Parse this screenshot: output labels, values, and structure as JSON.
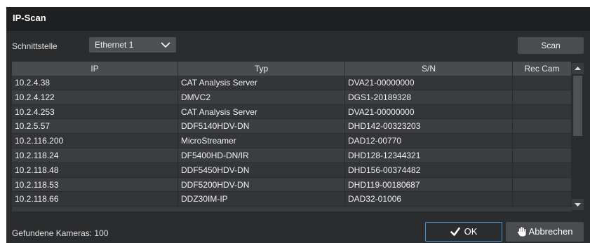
{
  "dialog": {
    "title": "IP-Scan",
    "interface_label": "Schnittstelle",
    "interface_value": "Ethernet 1",
    "scan_label": "Scan"
  },
  "table": {
    "headers": [
      "IP",
      "Typ",
      "S/N",
      "Rec Cam"
    ],
    "rows": [
      [
        "10.2.4.38",
        "CAT Analysis Server",
        "DVA21-00000000",
        ""
      ],
      [
        "10.2.4.122",
        "DMVC2",
        "DGS1-20189328",
        ""
      ],
      [
        "10.2.4.253",
        "CAT Analysis Server",
        "DVA21-00000000",
        ""
      ],
      [
        "10.2.5.57",
        "DDF5140HDV-DN",
        "DHD142-00323203",
        ""
      ],
      [
        "10.2.116.200",
        "MicroStreamer",
        "DAD12-00770",
        ""
      ],
      [
        "10.2.118.24",
        "DF5400HD-DN/IR",
        "DHD128-12344321",
        ""
      ],
      [
        "10.2.118.48",
        "DDF5450HDV-DN",
        "DHD156-00374482",
        ""
      ],
      [
        "10.2.118.53",
        "DDF5200HDV-DN",
        "DHD119-00180687",
        ""
      ],
      [
        "10.2.118.66",
        "DDZ30IM-IP",
        "DAD32-01006",
        ""
      ]
    ]
  },
  "footer": {
    "found_label": "Gefundene Kameras: 100",
    "ok_label": "OK",
    "cancel_label": "Abbrechen"
  },
  "icons": {
    "dropdown": "chevron-down-icon",
    "ok": "checkmark-icon",
    "cancel": "hand-icon",
    "scroll_up": "arrow-up-icon",
    "scroll_down": "arrow-down-icon"
  },
  "colors": {
    "accent": "#3e8fd6",
    "titlebar": "#1e1f21",
    "background": "#2b2c2e"
  }
}
